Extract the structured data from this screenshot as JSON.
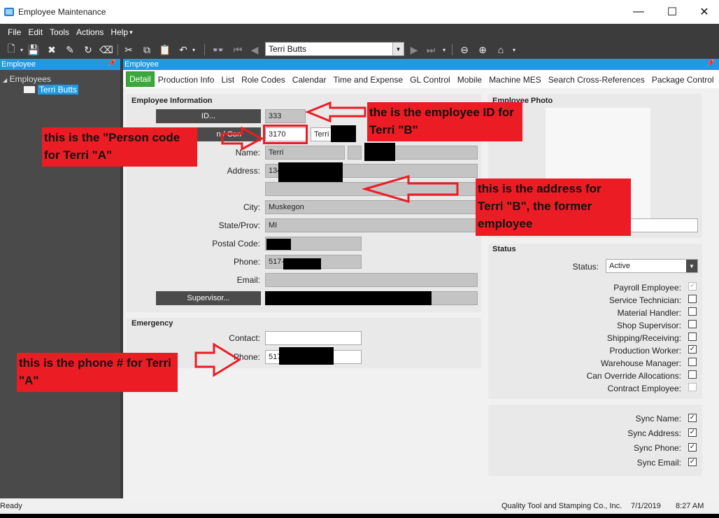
{
  "window": {
    "title": "Employee Maintenance",
    "minimize": "—",
    "maximize": "☐",
    "close": "✕"
  },
  "menu": [
    "File",
    "Edit",
    "Tools",
    "Actions",
    "Help"
  ],
  "toolbar": {
    "employee_combo_value": "Terri Butts"
  },
  "left_panel": {
    "title": "Employee",
    "tree_root": "Employees",
    "tree_child": "Terri Butts"
  },
  "right_panel": {
    "title": "Employee"
  },
  "tabs": [
    "Detail",
    "Production Info",
    "List",
    "Role Codes",
    "Calendar",
    "Time and Expense",
    "GL Control",
    "Mobile",
    "Machine MES",
    "Search Cross-References",
    "Package Control"
  ],
  "employee_info": {
    "title": "Employee Information",
    "id_button": "ID...",
    "id_value": "333",
    "person_button": "n / Con",
    "person_code": "3170",
    "person_name_partial": "Terri",
    "name_label": "Name:",
    "first_name": "Terri",
    "address_label": "Address:",
    "address_partial": "134",
    "city_label": "City:",
    "city": "Muskegon",
    "state_label": "State/Prov:",
    "state": "MI",
    "postal_label": "Postal Code:",
    "phone_label": "Phone:",
    "phone_partial": "517-",
    "email_label": "Email:",
    "supervisor_button": "Supervisor..."
  },
  "emergency": {
    "title": "Emergency",
    "contact_label": "Contact:",
    "phone_label": "Phone:",
    "phone_partial": "517"
  },
  "photo": {
    "title": "Employee Photo"
  },
  "status": {
    "title": "Status",
    "status_label": "Status:",
    "status_value": "Active",
    "checks": [
      {
        "label": "Payroll Employee:",
        "checked": true,
        "disabled": true
      },
      {
        "label": "Service Technician:",
        "checked": false,
        "disabled": false
      },
      {
        "label": "Material Handler:",
        "checked": false,
        "disabled": false
      },
      {
        "label": "Shop Supervisor:",
        "checked": false,
        "disabled": false
      },
      {
        "label": "Shipping/Receiving:",
        "checked": false,
        "disabled": false
      },
      {
        "label": "Production Worker:",
        "checked": true,
        "disabled": false
      },
      {
        "label": "Warehouse Manager:",
        "checked": false,
        "disabled": false
      },
      {
        "label": "Can Override Allocations:",
        "checked": false,
        "disabled": false
      },
      {
        "label": "Contract Employee:",
        "checked": false,
        "disabled": true
      }
    ]
  },
  "sync": [
    {
      "label": "Sync Name:",
      "checked": true
    },
    {
      "label": "Sync Address:",
      "checked": true
    },
    {
      "label": "Sync Phone:",
      "checked": true
    },
    {
      "label": "Sync Email:",
      "checked": true
    }
  ],
  "annotations": {
    "employee_id": "the is the employee ID for Terri \"B\"",
    "person_code": "this is the \"Person code for Terri \"A\"",
    "address": "this is the address for Terri \"B\", the former employee",
    "phone": "this is the phone # for Terri \"A\""
  },
  "statusbar": {
    "left": "Ready",
    "company": "Quality Tool and Stamping Co., Inc.",
    "date": "7/1/2019",
    "time": "8:27 AM"
  },
  "colors": {
    "accent": "#1e9be0",
    "active_tab": "#3aa83a",
    "annotation": "#ec1c24",
    "chrome_dark": "#3c3c3c"
  }
}
